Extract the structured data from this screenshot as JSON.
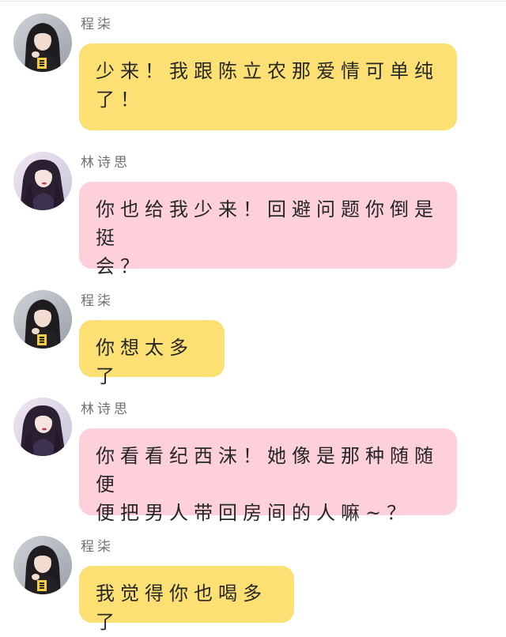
{
  "colors": {
    "yellow_bubble": "#fde073",
    "pink_bubble": "#fdd0db",
    "name_text": "#6f6f6f",
    "message_text": "#262626"
  },
  "messages": [
    {
      "sender": "程柒",
      "avatar": "avatar-chengqi",
      "text": "少来！我跟陈立农那爱情可单纯\n了！"
    },
    {
      "sender": "林诗思",
      "avatar": "avatar-linshisi",
      "text": "你也给我少来！回避问题你倒是挺\n会？"
    },
    {
      "sender": "程柒",
      "avatar": "avatar-chengqi",
      "text": "你想太多了"
    },
    {
      "sender": "林诗思",
      "avatar": "avatar-linshisi",
      "text": "你看看纪西沫！她像是那种随随便\n便把男人带回房间的人嘛~？"
    },
    {
      "sender": "程柒",
      "avatar": "avatar-chengqi",
      "text": "我觉得你也喝多了"
    }
  ]
}
